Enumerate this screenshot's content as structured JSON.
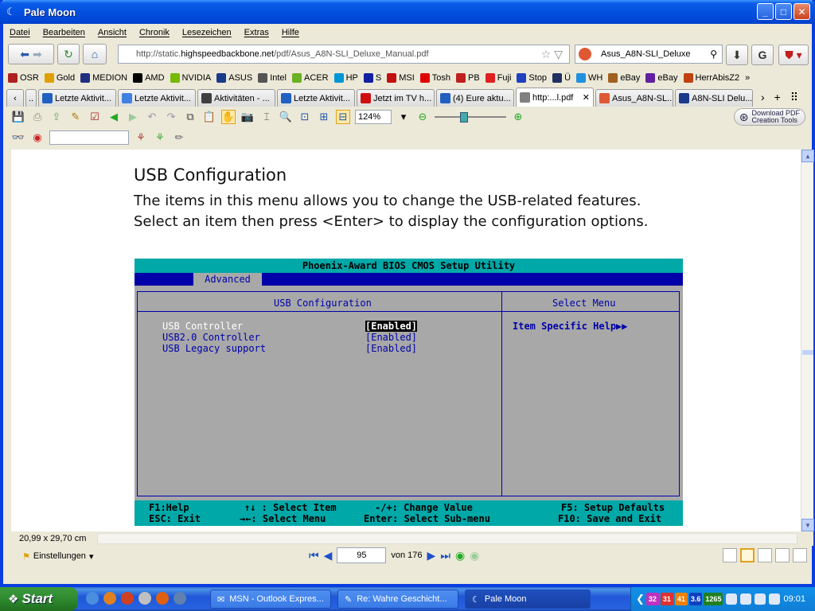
{
  "window": {
    "title": "Pale Moon"
  },
  "menu": [
    "Datei",
    "Bearbeiten",
    "Ansicht",
    "Chronik",
    "Lesezeichen",
    "Extras",
    "Hilfe"
  ],
  "nav": {
    "url_prefix": "http://static.",
    "url_domain": "highspeedbackbone.net",
    "url_suffix": "/pdf/Asus_A8N-SLI_Deluxe_Manual.pdf",
    "search_value": "Asus_A8N-SLI_Deluxe"
  },
  "bookmarks": [
    {
      "label": "OSR",
      "color": "#b02020"
    },
    {
      "label": "Gold",
      "color": "#e0a000"
    },
    {
      "label": "MEDION",
      "color": "#203080"
    },
    {
      "label": "AMD",
      "color": "#000000"
    },
    {
      "label": "NVIDIA",
      "color": "#76b900"
    },
    {
      "label": "ASUS",
      "color": "#1a3a8a"
    },
    {
      "label": "Intel",
      "color": "#555555"
    },
    {
      "label": "ACER",
      "color": "#6ab023"
    },
    {
      "label": "HP",
      "color": "#0096d6"
    },
    {
      "label": "S",
      "color": "#1020a0"
    },
    {
      "label": "MSI",
      "color": "#c01010"
    },
    {
      "label": "Tosh",
      "color": "#e00000"
    },
    {
      "label": "PB",
      "color": "#c02020"
    },
    {
      "label": "Fuji",
      "color": "#e02020"
    },
    {
      "label": "Stop",
      "color": "#2040c0"
    },
    {
      "label": "Ü",
      "color": "#203060"
    },
    {
      "label": "WH",
      "color": "#2090e0"
    },
    {
      "label": "eBay",
      "color": "#a06020"
    },
    {
      "label": "eBay",
      "color": "#6020a0"
    },
    {
      "label": "HerrAbisZ2",
      "color": "#c04010"
    }
  ],
  "tabs": [
    {
      "label": "Letzte Aktivit...",
      "color": "#2060c0",
      "active": false
    },
    {
      "label": "Letzte Aktivit...",
      "color": "#4080e0",
      "active": false
    },
    {
      "label": "Aktivitäten - ...",
      "color": "#404040",
      "active": false
    },
    {
      "label": "Letzte Aktivit...",
      "color": "#2060c0",
      "active": false
    },
    {
      "label": "Jetzt im TV h...",
      "color": "#d01010",
      "active": false
    },
    {
      "label": "(4) Eure aktu...",
      "color": "#2060c0",
      "active": false
    },
    {
      "label": "http:...l.pdf",
      "color": "#808080",
      "active": true
    },
    {
      "label": "Asus_A8N-SL...",
      "color": "#de5833",
      "active": false
    },
    {
      "label": "A8N-SLI Delu...",
      "color": "#1a3a8a",
      "active": false
    }
  ],
  "pdf_toolbar": {
    "zoom": "124%",
    "download_line1": "Download PDF",
    "download_line2": "Creation Tools"
  },
  "document": {
    "heading": "USB Configuration",
    "body_line1": "The items in this menu allows you to change the USB-related features.",
    "body_line2": "Select an item then press <Enter> to display the configuration options."
  },
  "bios": {
    "title": "Phoenix-Award BIOS CMOS Setup Utility",
    "tab": "Advanced",
    "left_title": "USB Configuration",
    "right_title": "Select Menu",
    "help": "Item Specific Help▶▶",
    "items": [
      {
        "label": "USB Controller",
        "value": "[Enabled]",
        "selected": true
      },
      {
        "label": "USB2.0 Controller",
        "value": "[Enabled]",
        "selected": false
      },
      {
        "label": "USB Legacy support",
        "value": "[Enabled]",
        "selected": false
      }
    ],
    "footer": {
      "f1": "F1:Help",
      "esc": "ESC: Exit",
      "select_item": "↑↓ : Select Item",
      "select_menu": "→←: Select Menu",
      "change_value": "-/+: Change Value",
      "sub_menu": "Enter: Select Sub-menu",
      "f5": "F5: Setup Defaults",
      "f10": "F10: Save and Exit"
    }
  },
  "status": {
    "paper_size": "20,99 x 29,70 cm",
    "settings": "Einstellungen",
    "page": "95",
    "page_of": "von 176"
  },
  "taskbar": {
    "start": "Start",
    "tasks": [
      {
        "label": "MSN - Outlook Expres...",
        "active": false
      },
      {
        "label": "Re: Wahre Geschicht...",
        "active": false
      },
      {
        "label": "Pale Moon",
        "active": true
      }
    ],
    "tray_badges": [
      {
        "text": "32",
        "color": "#c030c0"
      },
      {
        "text": "31",
        "color": "#e03030"
      },
      {
        "text": "41",
        "color": "#f08000"
      },
      {
        "text": "3.6",
        "color": "#1040c0"
      },
      {
        "text": "1265",
        "color": "#208020"
      }
    ],
    "clock": "09:01"
  }
}
